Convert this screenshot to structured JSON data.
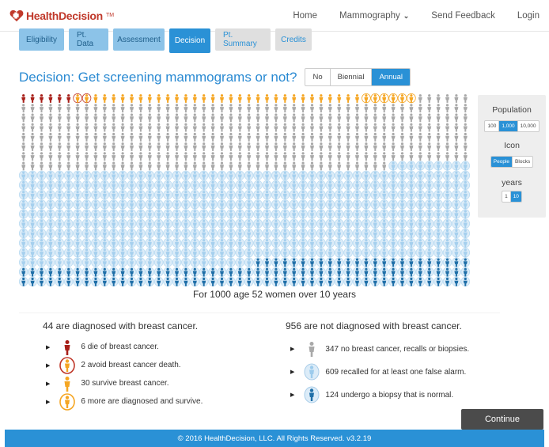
{
  "brand": {
    "name": "HealthDecision",
    "tm": "TM",
    "color": "#c0392b"
  },
  "nav": {
    "home": "Home",
    "mammography": "Mammography",
    "feedback": "Send Feedback",
    "login": "Login"
  },
  "tabs": [
    {
      "label": "Eligibility",
      "state": "done"
    },
    {
      "label": "Pt. Data",
      "state": "done"
    },
    {
      "label": "Assessment",
      "state": "done"
    },
    {
      "label": "Decision",
      "state": "active"
    },
    {
      "label": "Pt. Summary",
      "state": "todo"
    },
    {
      "label": "Credits",
      "state": "todo"
    }
  ],
  "decision": {
    "title": "Decision: Get screening mammograms or not?",
    "options": [
      "No",
      "Biennial",
      "Annual"
    ],
    "selected": "Annual"
  },
  "side_panel": {
    "population_label": "Population",
    "population_options": [
      "100",
      "1,000",
      "10,000"
    ],
    "population_selected": "1,000",
    "icon_label": "Icon",
    "icon_options": [
      "People",
      "Blocks"
    ],
    "icon_selected": "People",
    "years_label": "years",
    "years_options": [
      "1",
      "10"
    ],
    "years_selected": "10"
  },
  "icon_array": {
    "population": 1000,
    "counts": {
      "die": 6,
      "avoid_death": 2,
      "survive": 30,
      "more_diagnosed": 6,
      "no_cancer": 347,
      "false_alarm": 609,
      "biopsy_normal": 124
    },
    "colors": {
      "die": "#a8201a",
      "survive": "#f5a623",
      "ring": "#c0392b",
      "no_cancer": "#a9a9a9",
      "false_alarm": "#bcdcf2",
      "biopsy": "#1f6fa8"
    }
  },
  "caption": "For 1000 age 52 women over 10 years",
  "diagnosed": {
    "title": "44 are diagnosed with breast cancer.",
    "items": [
      {
        "text": "6 die of breast cancer.",
        "icon": "person-dark-red-icon"
      },
      {
        "text": "2 avoid breast cancer death.",
        "icon": "person-circled-red-icon"
      },
      {
        "text": "30 survive breast cancer.",
        "icon": "person-orange-icon"
      },
      {
        "text": "6 more are diagnosed and survive.",
        "icon": "person-circled-orange-icon"
      }
    ]
  },
  "not_diagnosed": {
    "title": "956 are not diagnosed with breast cancer.",
    "items": [
      {
        "text": "347 no breast cancer, recalls or biopsies.",
        "icon": "person-gray-icon"
      },
      {
        "text": "609 recalled for at least one false alarm.",
        "icon": "person-light-blue-icon"
      },
      {
        "text": "124 undergo a biopsy that is normal.",
        "icon": "person-dark-blue-icon"
      }
    ]
  },
  "continue_label": "Continue",
  "footer": "© 2016 HealthDecision, LLC. All Rights Reserved. v3.2.19"
}
